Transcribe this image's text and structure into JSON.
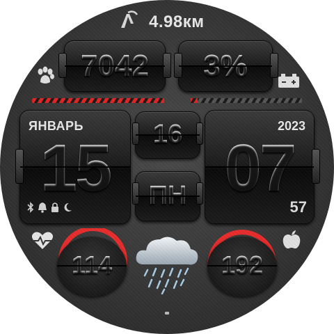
{
  "distance": {
    "value": "4.98км",
    "icon": "walking-route-icon"
  },
  "steps": {
    "value": "7042",
    "icon": "paw-icon"
  },
  "battery": {
    "value": "3%",
    "icon": "battery-icon",
    "level_fraction": 0.03
  },
  "steps_progress_fraction": 0.99,
  "date": {
    "month": "ЯНВАРЬ",
    "day": "15",
    "year": "2023",
    "week_number": "16",
    "weekday": "ПН"
  },
  "time": {
    "hours": "07",
    "seconds": "57"
  },
  "status_icons": [
    "bluetooth-icon",
    "alarm-bell-icon",
    "lock-icon",
    "moon-icon"
  ],
  "heart_rate": {
    "value": "114",
    "icon": "heart-pulse-icon",
    "arc_fraction": 0.45
  },
  "other_metric": {
    "value": "192",
    "icon": "apple-icon",
    "arc_fraction": 0.7
  },
  "weather": {
    "icon": "rain-cloud-icon"
  },
  "colors": {
    "accent": "#e02424",
    "text": "#ececec",
    "background": "#333333"
  }
}
